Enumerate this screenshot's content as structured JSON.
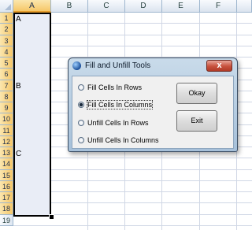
{
  "columns": [
    "A",
    "B",
    "C",
    "D",
    "E",
    "F"
  ],
  "selected_column": "A",
  "rows": [
    "1",
    "2",
    "3",
    "4",
    "5",
    "6",
    "7",
    "8",
    "9",
    "10",
    "11",
    "12",
    "13",
    "14",
    "15",
    "16",
    "17",
    "18",
    "19"
  ],
  "cells": {
    "A1": "A",
    "A7": "B",
    "A13": "C"
  },
  "dialog": {
    "title": "Fill and Unfill Tools",
    "close_label": "x",
    "options": [
      {
        "label": "Fill Cells In Rows",
        "selected": false
      },
      {
        "label": "Fill Cells In Columns",
        "selected": true
      },
      {
        "label": "Unfill Cells In Rows",
        "selected": false
      },
      {
        "label": "Unfill Cells In Columns",
        "selected": false
      }
    ],
    "okay_label": "Okay",
    "exit_label": "Exit"
  },
  "colors": {
    "selection_fill": "#e9edf6",
    "header_highlight": "#f6c768",
    "grid": "#d0d7e5"
  }
}
